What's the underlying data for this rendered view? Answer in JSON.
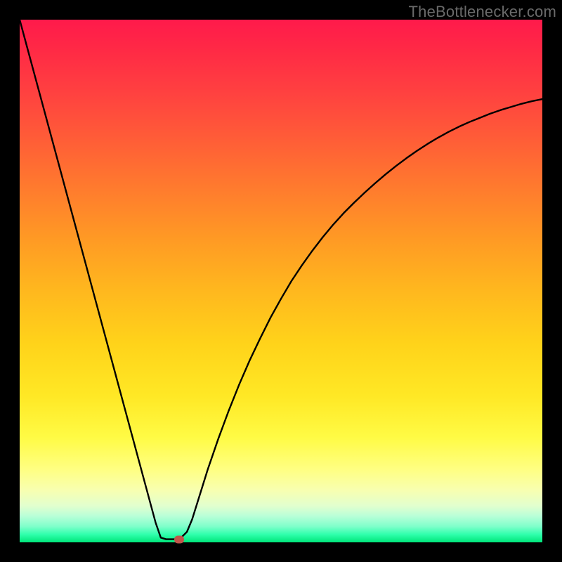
{
  "watermark": "TheBottlenecker.com",
  "chart_data": {
    "type": "line",
    "title": "",
    "xlabel": "",
    "ylabel": "",
    "xlim": [
      0,
      100
    ],
    "ylim": [
      0,
      100
    ],
    "x": [
      0,
      2,
      4,
      6,
      8,
      10,
      12,
      14,
      16,
      18,
      20,
      22,
      24,
      26,
      27,
      28,
      29,
      30,
      31,
      32,
      33,
      34,
      36,
      38,
      40,
      42,
      44,
      46,
      48,
      50,
      52,
      54,
      56,
      58,
      60,
      62,
      64,
      66,
      68,
      70,
      72,
      74,
      76,
      78,
      80,
      82,
      84,
      86,
      88,
      90,
      92,
      94,
      96,
      98,
      100
    ],
    "values": [
      100,
      92.6,
      85.2,
      77.8,
      70.4,
      63.0,
      55.6,
      48.2,
      40.8,
      33.4,
      26.0,
      18.6,
      11.2,
      3.8,
      0.9,
      0.6,
      0.6,
      0.6,
      1.0,
      2.0,
      4.4,
      7.6,
      14.0,
      19.8,
      25.2,
      30.2,
      34.8,
      39.0,
      43.0,
      46.6,
      50.0,
      53.0,
      55.8,
      58.4,
      60.8,
      63.0,
      65.0,
      66.9,
      68.7,
      70.4,
      72.0,
      73.5,
      74.9,
      76.2,
      77.4,
      78.5,
      79.5,
      80.4,
      81.2,
      82.0,
      82.7,
      83.3,
      83.9,
      84.4,
      84.8
    ],
    "marker": {
      "x": 30.5,
      "y": 0.6
    },
    "gradient_stops": [
      {
        "pos": 0.0,
        "color": "#ff1a4b"
      },
      {
        "pos": 0.5,
        "color": "#ffb81e"
      },
      {
        "pos": 0.8,
        "color": "#fffb45"
      },
      {
        "pos": 0.97,
        "color": "#7dffca"
      },
      {
        "pos": 1.0,
        "color": "#00e57a"
      }
    ]
  }
}
